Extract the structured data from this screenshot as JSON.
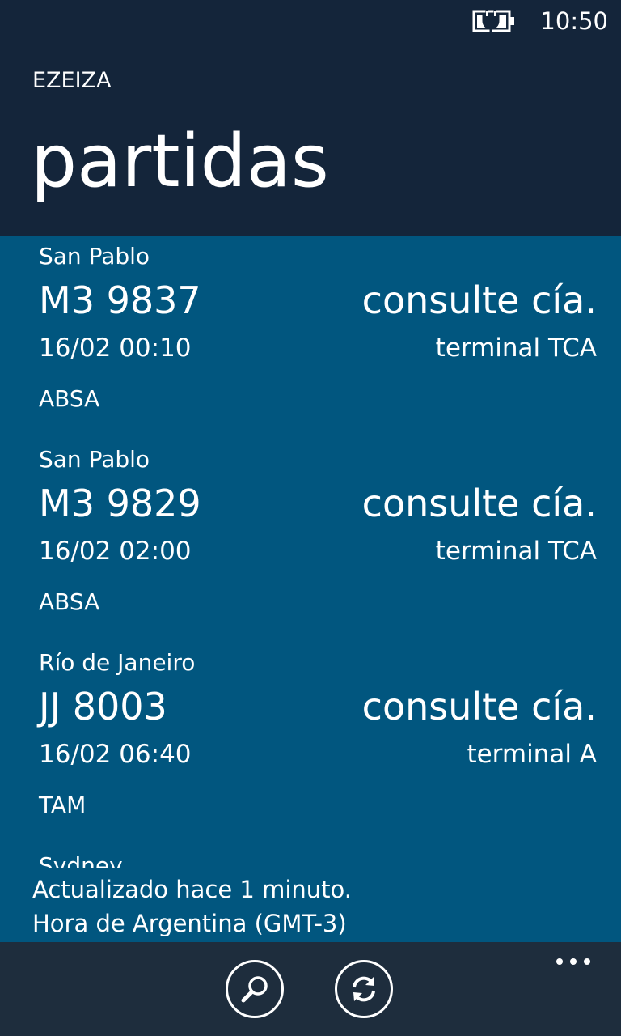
{
  "status_bar": {
    "time": "10:50",
    "battery_icon": "battery-charging-icon"
  },
  "header": {
    "app_title": "EZEIZA",
    "page_title": "partidas"
  },
  "flights": [
    {
      "destination": "San Pablo",
      "code": "M3 9837",
      "status": "consulte cía.",
      "datetime": "16/02 00:10",
      "terminal": "terminal TCA",
      "airline": "ABSA"
    },
    {
      "destination": "San Pablo",
      "code": "M3 9829",
      "status": "consulte cía.",
      "datetime": "16/02 02:00",
      "terminal": "terminal TCA",
      "airline": "ABSA"
    },
    {
      "destination": "Río de Janeiro",
      "code": "JJ 8003",
      "status": "consulte cía.",
      "datetime": "16/02 06:40",
      "terminal": "terminal A",
      "airline": "TAM"
    },
    {
      "destination": "Sydney"
    }
  ],
  "footer": {
    "updated": "Actualizado hace 1 minuto.",
    "timezone": "Hora de Argentina (GMT-3)"
  },
  "app_bar": {
    "buttons": [
      "search-icon",
      "refresh-icon"
    ],
    "more": "ellipsis-icon"
  },
  "colors": {
    "header_bg": "#14253a",
    "list_bg": "#01567f",
    "app_bar_bg": "#1e2d3d",
    "text": "#ffffff"
  }
}
